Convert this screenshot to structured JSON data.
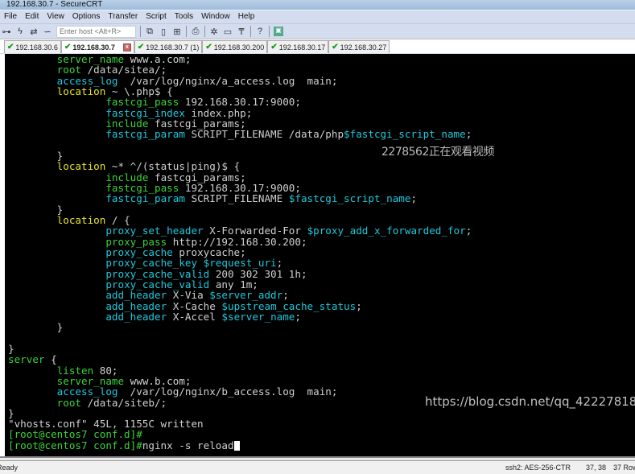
{
  "window": {
    "title": "192.168.30.7 - SecureCRT"
  },
  "menu": [
    "File",
    "Edit",
    "View",
    "Options",
    "Transfer",
    "Script",
    "Tools",
    "Window",
    "Help"
  ],
  "toolbar": {
    "host_placeholder": "Enter host <Alt+R>",
    "icons": [
      "connect-icon",
      "lightning-icon",
      "reconnect-icon",
      "disconnect-icon",
      "copy-icon",
      "paste-icon",
      "find-icon",
      "print-icon",
      "settings-icon",
      "keymap-icon",
      "key-icon",
      "help-icon",
      "sftp-icon"
    ]
  },
  "tabs": [
    {
      "label": "192.168.30.6",
      "active": false
    },
    {
      "label": "192.168.30.7",
      "active": true
    },
    {
      "label": "192.168.30.7 (1)",
      "active": false
    },
    {
      "label": "192.168.30.200",
      "active": false
    },
    {
      "label": "192.168.30.17",
      "active": false
    },
    {
      "label": "192.168.30.27",
      "active": false
    }
  ],
  "colors": {
    "g": "#3cd23c",
    "c": "#1ec8dc",
    "y": "#e6e61e",
    "w": "#d0d0d0"
  },
  "terminal": {
    "lines": [
      [
        [
          "        ",
          "w"
        ],
        [
          "server_name",
          "g"
        ],
        [
          " www.a.com;",
          "w"
        ]
      ],
      [
        [
          "        ",
          "w"
        ],
        [
          "root",
          "g"
        ],
        [
          " /data/sitea/;",
          "w"
        ]
      ],
      [
        [
          "        ",
          "w"
        ],
        [
          "access_log",
          "c"
        ],
        [
          "  /var/log/nginx/a_access.log  main;",
          "w"
        ]
      ],
      [
        [
          "        ",
          "w"
        ],
        [
          "location",
          "y"
        ],
        [
          " ~ \\.php$ {",
          "w"
        ]
      ],
      [
        [
          "                ",
          "w"
        ],
        [
          "fastcgi_pass",
          "g"
        ],
        [
          " 192.168.30.17:9000;",
          "w"
        ]
      ],
      [
        [
          "                ",
          "w"
        ],
        [
          "fastcgi_index",
          "c"
        ],
        [
          " index.php;",
          "w"
        ]
      ],
      [
        [
          "                ",
          "w"
        ],
        [
          "include",
          "g"
        ],
        [
          " fastcgi_params;",
          "w"
        ]
      ],
      [
        [
          "                ",
          "w"
        ],
        [
          "fastcgi_param",
          "c"
        ],
        [
          " SCRIPT_FILENAME /data/php",
          "w"
        ],
        [
          "$fastcgi_script_name",
          "c"
        ],
        [
          ";",
          "w"
        ]
      ],
      [
        [
          "",
          "w"
        ]
      ],
      [
        [
          "        }",
          "w"
        ]
      ],
      [
        [
          "        ",
          "w"
        ],
        [
          "location",
          "y"
        ],
        [
          " ~* ^/(status|ping)$ {",
          "w"
        ]
      ],
      [
        [
          "                ",
          "w"
        ],
        [
          "include",
          "g"
        ],
        [
          " fastcgi_params;",
          "w"
        ]
      ],
      [
        [
          "                ",
          "w"
        ],
        [
          "fastcgi_pass",
          "g"
        ],
        [
          " 192.168.30.17:9000;",
          "w"
        ]
      ],
      [
        [
          "                ",
          "w"
        ],
        [
          "fastcgi_param",
          "c"
        ],
        [
          " SCRIPT_FILENAME ",
          "w"
        ],
        [
          "$fastcgi_script_name",
          "c"
        ],
        [
          ";",
          "w"
        ]
      ],
      [
        [
          "        }",
          "w"
        ]
      ],
      [
        [
          "        ",
          "w"
        ],
        [
          "location",
          "y"
        ],
        [
          " / {",
          "w"
        ]
      ],
      [
        [
          "                ",
          "w"
        ],
        [
          "proxy_set_header",
          "c"
        ],
        [
          " X-Forwarded-For ",
          "w"
        ],
        [
          "$proxy_add_x_forwarded_for",
          "c"
        ],
        [
          ";",
          "w"
        ]
      ],
      [
        [
          "                ",
          "w"
        ],
        [
          "proxy_pass",
          "g"
        ],
        [
          " http://192.168.30.200;",
          "w"
        ]
      ],
      [
        [
          "                ",
          "w"
        ],
        [
          "proxy_cache",
          "c"
        ],
        [
          " proxycache;",
          "w"
        ]
      ],
      [
        [
          "                ",
          "w"
        ],
        [
          "proxy_cache_key",
          "c"
        ],
        [
          " ",
          "w"
        ],
        [
          "$request_uri",
          "c"
        ],
        [
          ";",
          "w"
        ]
      ],
      [
        [
          "                ",
          "w"
        ],
        [
          "proxy_cache_valid",
          "c"
        ],
        [
          " 200 302 301 1h;",
          "w"
        ]
      ],
      [
        [
          "                ",
          "w"
        ],
        [
          "proxy_cache_valid",
          "c"
        ],
        [
          " any 1m;",
          "w"
        ]
      ],
      [
        [
          "                ",
          "w"
        ],
        [
          "add_header",
          "c"
        ],
        [
          " X-Via ",
          "w"
        ],
        [
          "$server_addr",
          "c"
        ],
        [
          ";",
          "w"
        ]
      ],
      [
        [
          "                ",
          "w"
        ],
        [
          "add_header",
          "c"
        ],
        [
          " X-Cache ",
          "w"
        ],
        [
          "$upstream_cache_status",
          "c"
        ],
        [
          ";",
          "w"
        ]
      ],
      [
        [
          "                ",
          "w"
        ],
        [
          "add_header",
          "c"
        ],
        [
          " X-Accel ",
          "w"
        ],
        [
          "$server_name",
          "c"
        ],
        [
          ";",
          "w"
        ]
      ],
      [
        [
          "        }",
          "w"
        ]
      ],
      [
        [
          "",
          "w"
        ]
      ],
      [
        [
          "}",
          "w"
        ]
      ],
      [
        [
          "server",
          "g"
        ],
        [
          " {",
          "w"
        ]
      ],
      [
        [
          "        ",
          "w"
        ],
        [
          "listen",
          "g"
        ],
        [
          " 80;",
          "w"
        ]
      ],
      [
        [
          "        ",
          "w"
        ],
        [
          "server_name",
          "g"
        ],
        [
          " www.b.com;",
          "w"
        ]
      ],
      [
        [
          "        ",
          "w"
        ],
        [
          "access_log",
          "c"
        ],
        [
          "  /var/log/nginx/b_access.log  main;",
          "w"
        ]
      ],
      [
        [
          "        ",
          "w"
        ],
        [
          "root",
          "g"
        ],
        [
          " /data/siteb/;",
          "w"
        ]
      ],
      [
        [
          "}",
          "w"
        ]
      ],
      [
        [
          "\"vhosts.conf\" 45L, 1155C written",
          "w"
        ]
      ],
      [
        [
          "[root@centos7 conf.d]#",
          "g"
        ]
      ],
      [
        [
          "[root@centos7 conf.d]#",
          "g"
        ],
        [
          "nginx -s reload",
          "w"
        ]
      ]
    ]
  },
  "overlay": {
    "viewer_notice": "2278562正在观看视频",
    "watermark": "https://blog.csdn.net/qq_42227818"
  },
  "status": {
    "ready": "Ready",
    "cipher": "ssh2: AES-256-CTR",
    "cursor_pos": "37,  38",
    "rows": "37 Rows"
  }
}
